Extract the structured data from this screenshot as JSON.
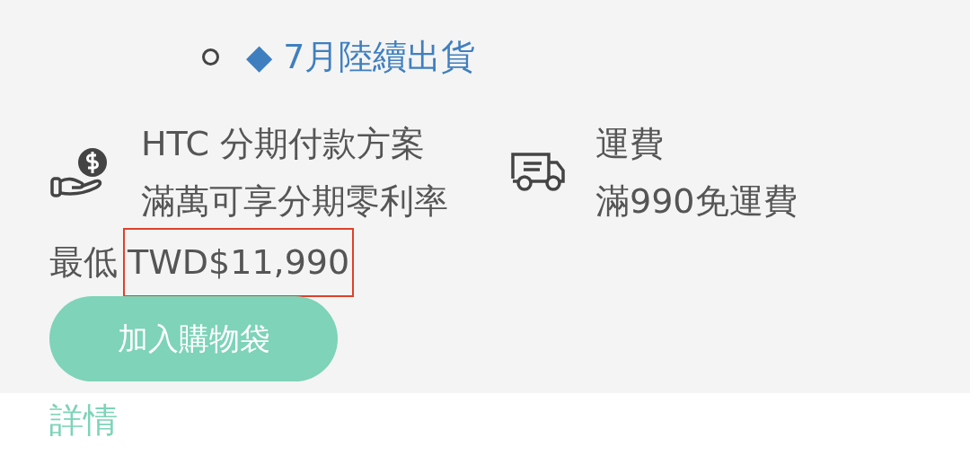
{
  "shipping_note": {
    "text": "◆ 7月陸續出貨"
  },
  "features": [
    {
      "kind": "installment",
      "title": "HTC 分期付款方案",
      "detail": "滿萬可享分期零利率"
    },
    {
      "kind": "shipping",
      "title": "運費",
      "detail": "滿990免運費"
    }
  ],
  "price": {
    "label": "最低",
    "amount": "TWD$11,990",
    "highlighted": true
  },
  "add_button": {
    "label": "加入購物袋"
  },
  "details_link": {
    "label": "詳情"
  }
}
